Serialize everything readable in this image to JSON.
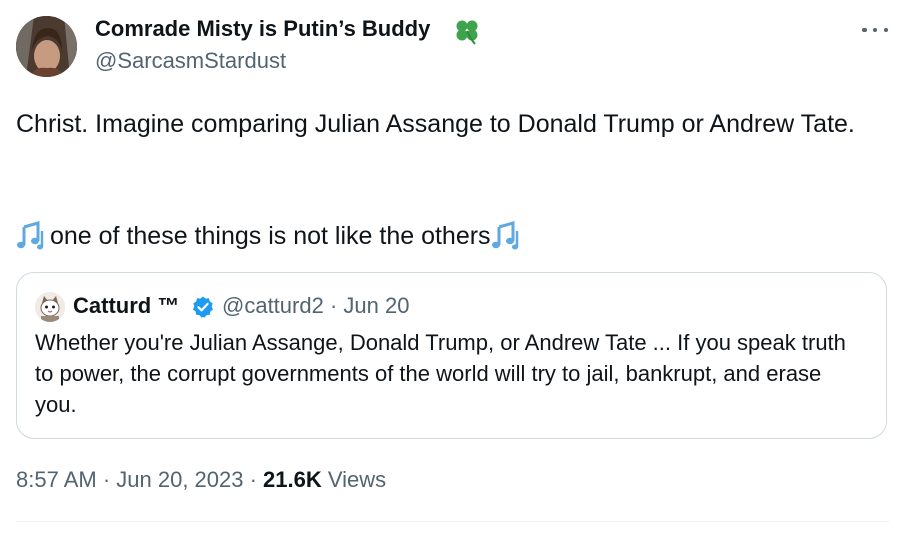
{
  "author": {
    "name": "Comrade Misty is Putin’s Buddy",
    "handle": "@SarcasmStardust",
    "badge_icon": "four-leaf-clover-icon"
  },
  "tweet": {
    "line1": "Christ. Imagine comparing Julian Assange to Donald Trump or Andrew Tate.",
    "line2": "one of these things is not like the others",
    "emoji_icon": "musical-notes-icon"
  },
  "quoted": {
    "name": "Catturd ™",
    "handle_date": "@catturd2 · Jun 20",
    "verified_icon": "verified-badge-icon",
    "text": "Whether you're Julian Assange, Donald Trump, or Andrew Tate ... If you speak truth to power, the corrupt governments of the world will try to jail, bankrupt, and erase you."
  },
  "meta": {
    "time_date": "8:57 AM · Jun 20, 2023 · ",
    "views_count": "21.6K",
    "views_label": " Views"
  },
  "colors": {
    "text": "#0f1419",
    "secondary": "#536471",
    "verified": "#1d9bf0",
    "border": "#cfd9de",
    "clover": "#3fa34d"
  }
}
